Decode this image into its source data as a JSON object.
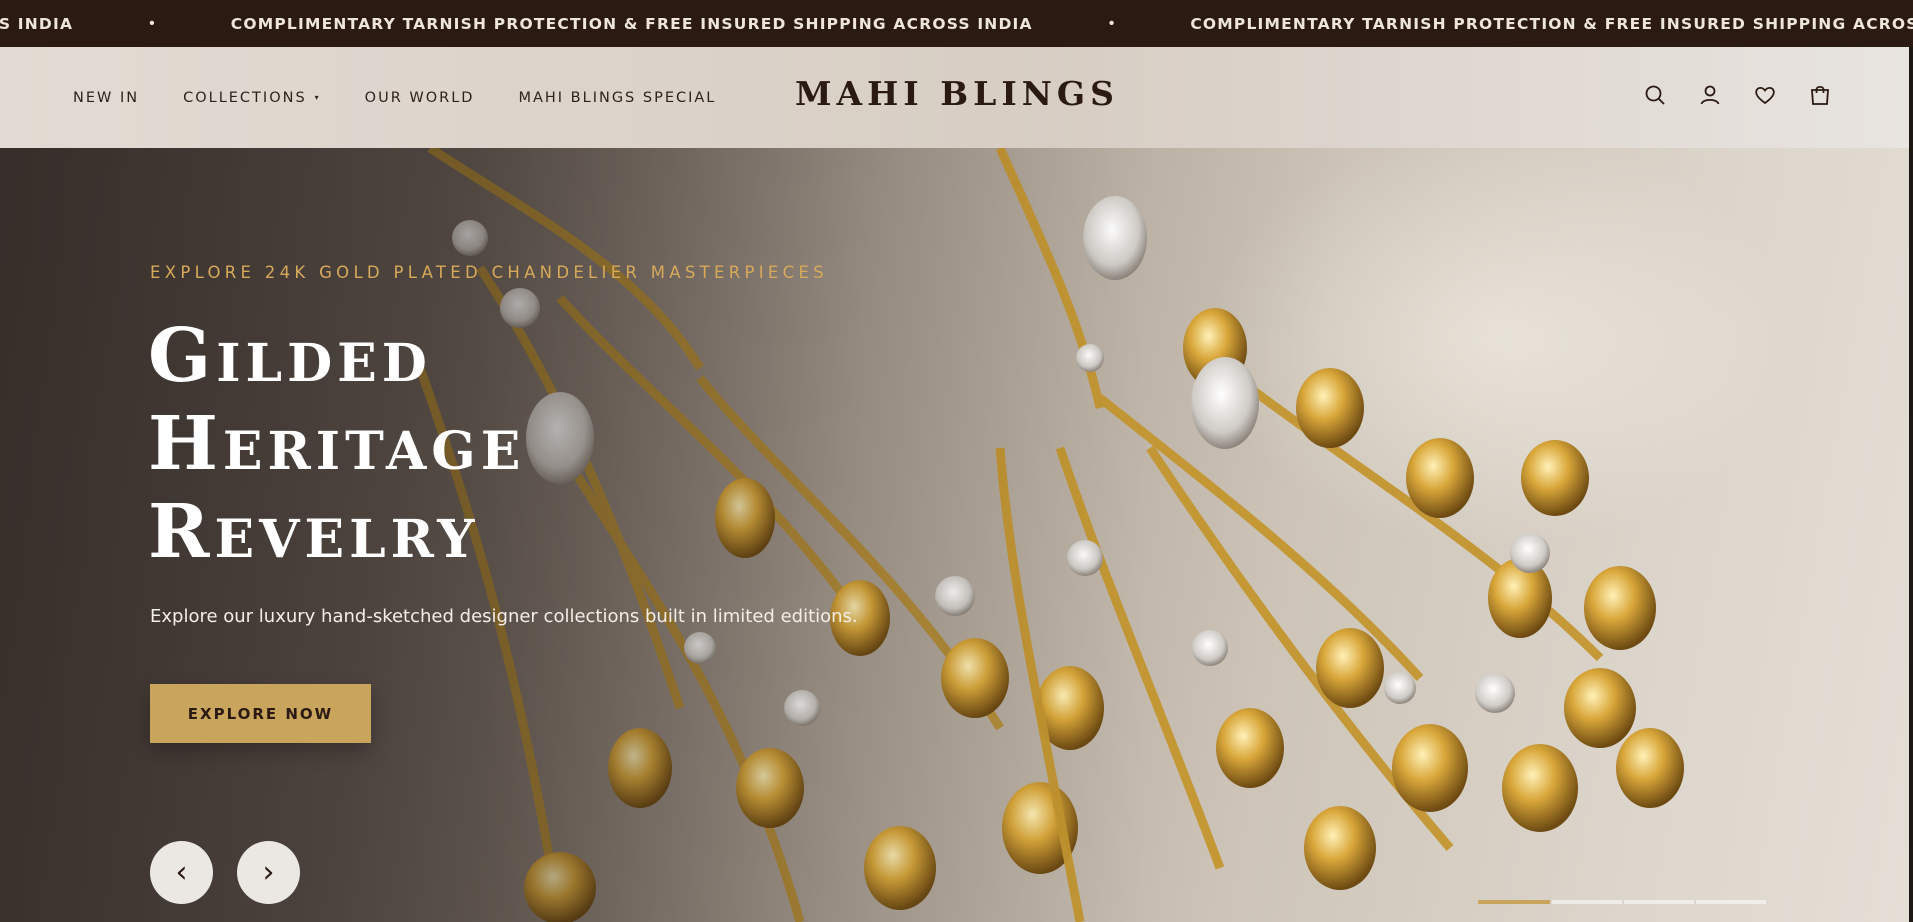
{
  "announcement": {
    "items": [
      "RED SHIPPING ACROSS INDIA",
      "COMPLIMENTARY TARNISH PROTECTION & FREE INSURED SHIPPING ACROSS INDIA",
      "COMPLIMENTARY TARNISH PROTECTION & FREE INSURED SHIPPING ACROSS INDIA"
    ],
    "separator": "•"
  },
  "header": {
    "nav": [
      {
        "label": "NEW IN"
      },
      {
        "label": "COLLECTIONS",
        "caret": "▾"
      },
      {
        "label": "OUR WORLD"
      },
      {
        "label": "MAHI BLINGS SPECIAL"
      }
    ],
    "brand": "MAHI BLINGS",
    "icons": [
      "search-icon",
      "account-icon",
      "wishlist-heart-icon",
      "cart-bag-icon"
    ]
  },
  "hero": {
    "eyebrow": "EXPLORE 24K GOLD PLATED CHANDELIER MASTERPIECES",
    "headline": [
      "Gilded",
      "Heritage",
      "Revelry"
    ],
    "subcopy": "Explore our luxury hand-sketched designer collections built in limited editions.",
    "cta_label": "EXPLORE NOW",
    "prev_arrow": "‹",
    "next_arrow": "›",
    "slides_total": 4,
    "active_slide": 1
  },
  "colors": {
    "announcement_bg": "#2a1a12",
    "accent_gold": "#c9a45c",
    "eyebrow_gold": "#d7a95a",
    "brand_text": "#2a1a12"
  }
}
